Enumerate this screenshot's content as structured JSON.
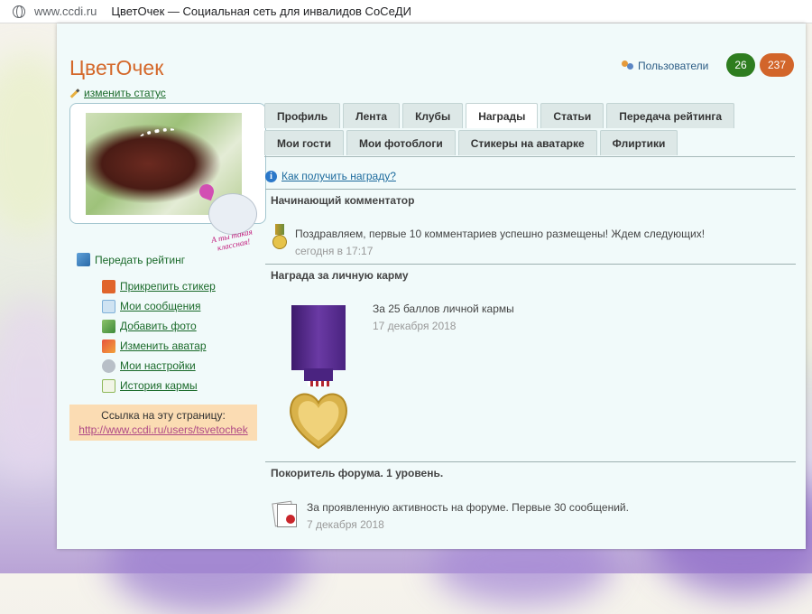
{
  "browser": {
    "url": "www.ccdi.ru",
    "tab_title": "ЦветОчек — Социальная сеть для инвалидов СоСеДИ"
  },
  "profile": {
    "name": "ЦветОчек",
    "change_status": "изменить статус",
    "sticker_caption": "А ты такая классная!"
  },
  "header": {
    "users_label": "Пользователи",
    "badge_green": "26",
    "badge_orange": "237"
  },
  "sidebar": {
    "transfer_rating": "Передать рейтинг",
    "menu": [
      {
        "label": "Прикрепить стикер",
        "icon": "gift-icon",
        "color": "#e0652c"
      },
      {
        "label": "Мои сообщения",
        "icon": "envelope-icon",
        "color": "#7fb0d8"
      },
      {
        "label": "Добавить фото",
        "icon": "add-photo-icon",
        "color": "#6aa85a"
      },
      {
        "label": "Изменить аватар",
        "icon": "change-avatar-icon",
        "color": "#d9473a"
      },
      {
        "label": "Мои настройки",
        "icon": "settings-gear-icon",
        "color": "#9aa3ad"
      },
      {
        "label": "История кармы",
        "icon": "karma-chart-icon",
        "color": "#8fb85a"
      }
    ],
    "page_link_label": "Ссылка на эту страницу:",
    "page_link_url": "http://www.ccdi.ru/users/tsvetochek"
  },
  "tabs": {
    "row1": [
      "Профиль",
      "Лента",
      "Клубы",
      "Награды",
      "Статьи",
      "Передача рейтинга"
    ],
    "row2": [
      "Мои гости",
      "Мои фотоблоги",
      "Стикеры на аватарке",
      "Флиртики"
    ],
    "active": "Награды"
  },
  "awards": {
    "howto_link": "Как получить награду?",
    "items": [
      {
        "title": "Начинающий комментатор",
        "text": "Поздравляем, первые 10 комментариев успешно размещены! Ждем следующих!",
        "date": "сегодня в 17:17"
      },
      {
        "title": "Награда за личную карму",
        "text": "За 25 баллов личной кармы",
        "date": "17 декабря 2018"
      },
      {
        "title": "Покоритель форума. 1 уровень.",
        "text": "За проявленную активность на форуме. Первые 30 сообщений.",
        "date": "7 декабря 2018"
      }
    ]
  }
}
